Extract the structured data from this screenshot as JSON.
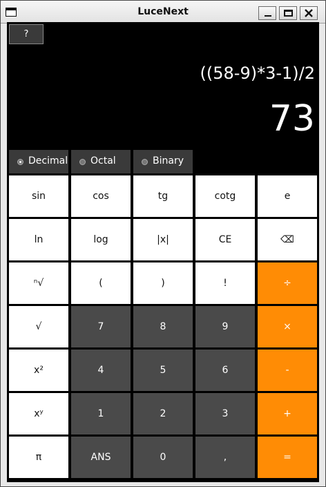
{
  "window": {
    "title": "LuceNext",
    "icon": "app-window-icon",
    "controls": {
      "minimize_icon": "minimize-icon",
      "maximize_icon": "maximize-icon",
      "close_icon": "close-icon"
    }
  },
  "toolbar": {
    "help_label": "?"
  },
  "display": {
    "expression": "((58-9)*3-1)/2",
    "result": "73"
  },
  "modes": [
    {
      "label": "Decimal",
      "selected": true
    },
    {
      "label": "Octal",
      "selected": false
    },
    {
      "label": "Binary",
      "selected": false
    }
  ],
  "keys": {
    "row1": [
      "sin",
      "cos",
      "tg",
      "cotg",
      "e"
    ],
    "row2": [
      "ln",
      "log",
      "|x|",
      "CE",
      "⌫"
    ],
    "row3": [
      "ⁿ√",
      "(",
      ")",
      "!",
      "÷"
    ],
    "row4": [
      "√",
      "7",
      "8",
      "9",
      "×"
    ],
    "row5": [
      "x²",
      "4",
      "5",
      "6",
      "-"
    ],
    "row6": [
      "xʸ",
      "1",
      "2",
      "3",
      "+"
    ],
    "row7": [
      "π",
      "ANS",
      "0",
      ",",
      "="
    ]
  },
  "colors": {
    "background": "#000000",
    "function_key": "#ffffff",
    "digit_key": "#4a4a4a",
    "operator_key": "#ff8c05",
    "mode_button": "#3a3a3a"
  }
}
